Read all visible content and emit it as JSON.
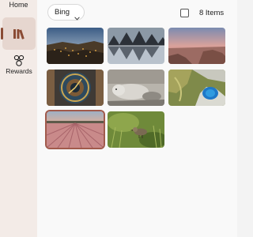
{
  "sidebar": {
    "home_label": "Home",
    "items": [
      {
        "name": "library",
        "icon": "library-books-icon",
        "selected": true
      },
      {
        "name": "rewards",
        "label": "Rewards",
        "icon": "rewards-icon"
      }
    ]
  },
  "toolbar": {
    "source_value": "Bing",
    "select_all_checked": false,
    "items_count": "8 Items"
  },
  "gallery": {
    "images": [
      {
        "name": "cliff-town-night",
        "selected": false
      },
      {
        "name": "pyramid-reflection",
        "selected": false
      },
      {
        "name": "coastal-sunset-rocks",
        "selected": false
      },
      {
        "name": "astronomical-clock",
        "selected": false
      },
      {
        "name": "sleeping-seal",
        "selected": false
      },
      {
        "name": "aerial-blue-lake",
        "selected": false
      },
      {
        "name": "tulip-field",
        "selected": true
      },
      {
        "name": "bird-in-grass",
        "selected": false
      }
    ]
  },
  "colors": {
    "accent": "#8a4b34",
    "sidebar_bg": "#f3ebe7",
    "selected_nav_bg": "#e6d6cf"
  }
}
